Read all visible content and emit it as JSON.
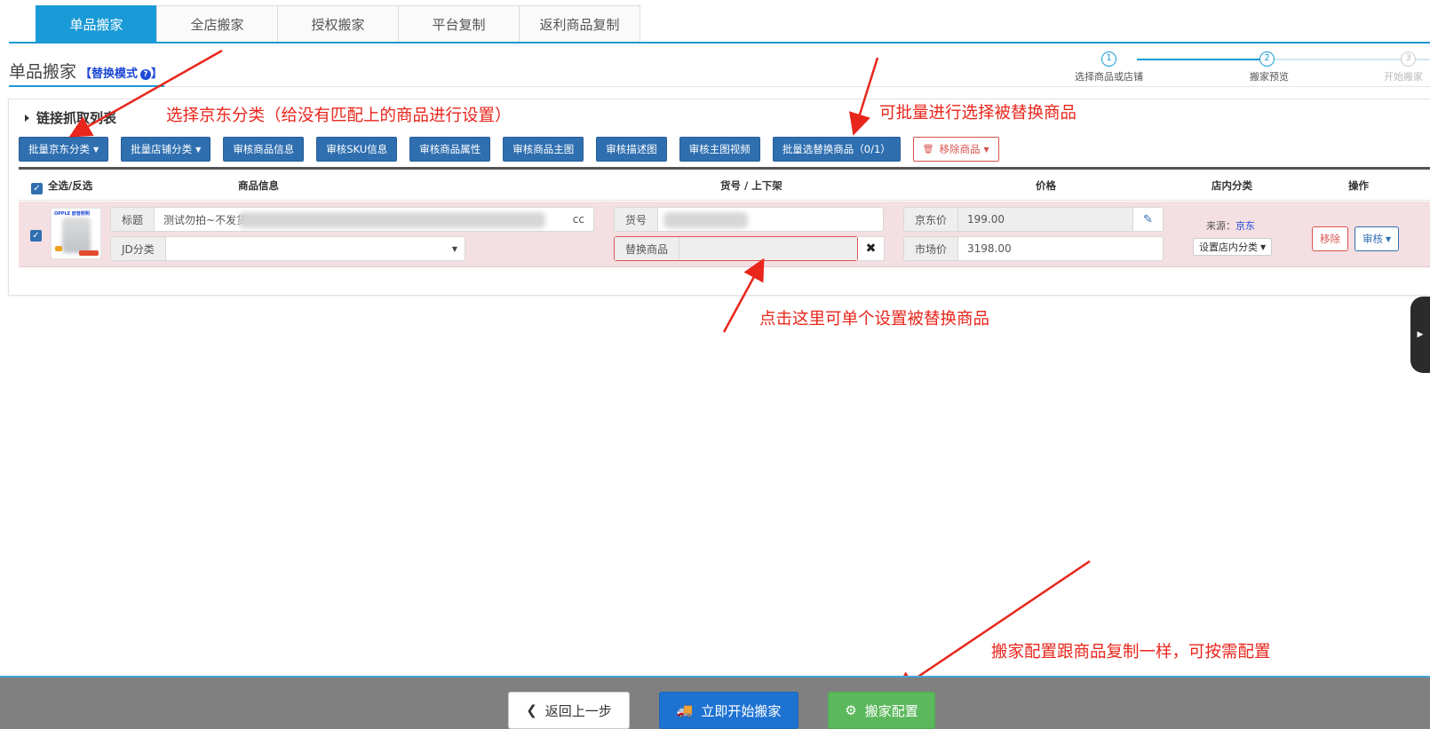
{
  "tabs": [
    {
      "label": "单品搬家",
      "active": true
    },
    {
      "label": "全店搬家"
    },
    {
      "label": "授权搬家"
    },
    {
      "label": "平台复制"
    },
    {
      "label": "返利商品复制"
    }
  ],
  "page": {
    "title": "单品搬家",
    "mode_open": "【",
    "mode_label": "替换模式",
    "mode_help_icon": "?",
    "mode_close": "】"
  },
  "steps": [
    {
      "number": "1",
      "label": "选择商品或店铺",
      "status": "done"
    },
    {
      "number": "2",
      "label": "搬家预览",
      "status": "current"
    },
    {
      "number": "3",
      "label": "开始搬家",
      "status": "pending"
    }
  ],
  "panel": {
    "title": "链接抓取列表"
  },
  "toolbar": [
    {
      "label": "批量京东分类",
      "dropdown": true
    },
    {
      "label": "批量店铺分类",
      "dropdown": true
    },
    {
      "label": "审核商品信息"
    },
    {
      "label": "审核SKU信息"
    },
    {
      "label": "审核商品属性"
    },
    {
      "label": "审核商品主图"
    },
    {
      "label": "审核描述图"
    },
    {
      "label": "审核主图视频"
    },
    {
      "label": "批量选替换商品（0/1）"
    }
  ],
  "remove_goods": {
    "label": "移除商品",
    "icon": "trash-icon"
  },
  "table": {
    "select_all": "全选/反选",
    "headers": {
      "info": "商品信息",
      "code": "货号 / 上下架",
      "price": "价格",
      "shop_category": "店内分类",
      "actions": "操作"
    }
  },
  "row": {
    "checked": true,
    "thumb_brand": "OPPLE 欧普照明",
    "title_label": "标题",
    "title_value": "测试勿拍~不发货",
    "title_tail": "cc",
    "jd_category_label": "JD分类",
    "jd_category_value": "",
    "code_label": "货号",
    "code_value": "",
    "replace_label": "替换商品",
    "replace_value": "",
    "jd_price_label": "京东价",
    "jd_price_value": "199.00",
    "market_price_label": "市场价",
    "market_price_value": "3198.00",
    "source_label": "来源：",
    "source_value": "京东",
    "shop_category_button": "设置店内分类",
    "remove_button": "移除",
    "review_button": "审核"
  },
  "annotations": {
    "a1": "选择京东分类（给没有匹配上的商品进行设置）",
    "a2": "可批量进行选择被替换商品",
    "a3": "点击这里可单个设置被替换商品",
    "a4": "搬家配置跟商品复制一样，可按需配置"
  },
  "footer": {
    "back": "返回上一步",
    "start": "立即开始搬家",
    "config": "搬家配置"
  },
  "colors": {
    "primary": "#1a9ad6",
    "button_blue": "#2f6fb0",
    "danger": "#d9534f",
    "success": "#5cb85c",
    "annotation": "#e8261c",
    "row_highlight": "#f4dfe2",
    "footer_bg": "#808080"
  }
}
